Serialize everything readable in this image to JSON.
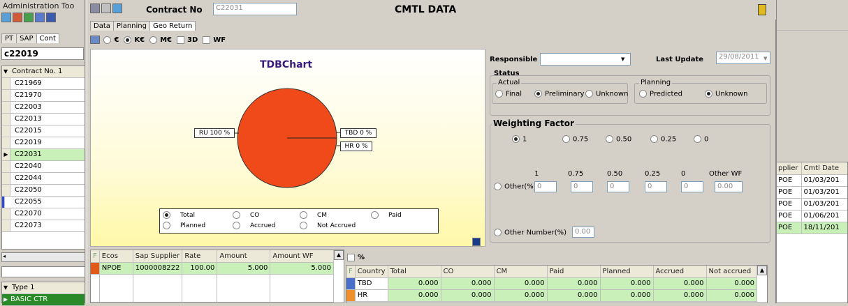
{
  "left_panel": {
    "menu_label": "Administration  Too",
    "tabs": [
      "PT",
      "SAP",
      "Cont"
    ],
    "current_contract": "c22019",
    "list_header": "Contract No. 1",
    "contracts": [
      "C21969",
      "C21970",
      "C22003",
      "C22013",
      "C22015",
      "C22019",
      "C22031",
      "C22040",
      "C22044",
      "C22050",
      "C22055",
      "C22070",
      "C22073"
    ],
    "type_header": "Type 1",
    "type_row": "BASIC CTR"
  },
  "window": {
    "contract_label": "Contract No",
    "contract_value": "C22031",
    "title": "CMTL DATA",
    "tabs": [
      "Data",
      "Planning",
      "Geo Return"
    ],
    "currency_options": [
      "€",
      "K€",
      "M€"
    ],
    "currency_selected": "K€",
    "view_options": [
      "3D",
      "WF"
    ]
  },
  "chart": {
    "title": "TDBChart",
    "labels": [
      "RU 100 %",
      "TBD 0 %",
      "HR 0 %"
    ],
    "color": "#f04a1a"
  },
  "chart_data": {
    "type": "pie",
    "title": "TDBChart",
    "categories": [
      "RU",
      "TBD",
      "HR"
    ],
    "values": [
      100,
      0,
      0
    ]
  },
  "chart_options": {
    "row1": [
      "Total",
      "CO",
      "CM",
      "Paid"
    ],
    "row2": [
      "Planned",
      "Accrued",
      "Not Accrued"
    ],
    "selected": "Total"
  },
  "details": {
    "responsible_label": "Responsible",
    "responsible_value": "",
    "last_update_label": "Last Update",
    "last_update_value": "29/08/2011",
    "status_label": "Status",
    "actual_label": "Actual",
    "actual_options": [
      "Final",
      "Preliminary",
      "Unknown"
    ],
    "actual_selected": "Preliminary",
    "planning_label": "Planning",
    "planning_options": [
      "Predicted",
      "Unknown"
    ],
    "planning_selected": "Unknown",
    "weighting_label": "Weighting Factor",
    "weight_options": [
      "1",
      "0.75",
      "0.50",
      "0.25",
      "0"
    ],
    "weight_selected": "1",
    "other_headers": [
      "1",
      "0.75",
      "0.50",
      "0.25",
      "0",
      "Other WF"
    ],
    "other_label": "Other(%)",
    "other_values": [
      "0",
      "0",
      "0",
      "0",
      "0",
      "0.00"
    ],
    "other_number_label": "Other Number(%)",
    "other_number_value": "0.00"
  },
  "supplier_table": {
    "headers": [
      "F",
      "Ecos",
      "Sap Supplier",
      "Rate",
      "Amount",
      "Amount WF"
    ],
    "rows": [
      {
        "ecos": "NPOE",
        "sap": "1000008222",
        "rate": "100.00",
        "amount": "5.000",
        "amount_wf": "5.000"
      }
    ]
  },
  "country_table": {
    "percent_label": "%",
    "headers": [
      "F",
      "Country",
      "Total",
      "CO",
      "CM",
      "Paid",
      "Planned",
      "Accrued",
      "Not accrued"
    ],
    "rows": [
      {
        "country": "TBD",
        "values": [
          "0.000",
          "0.000",
          "0.000",
          "0.000",
          "0.000",
          "0.000",
          "0.000"
        ],
        "flag": "#4a6fc8"
      },
      {
        "country": "HR",
        "values": [
          "0.000",
          "0.000",
          "0.000",
          "0.000",
          "0.000",
          "0.000",
          "0.000"
        ],
        "flag": "#f0902a"
      }
    ]
  },
  "right_table": {
    "headers": [
      "pplier",
      "Cmtl Date"
    ],
    "rows": [
      [
        "POE",
        "01/03/201"
      ],
      [
        "POE",
        "01/03/201"
      ],
      [
        "POE",
        "01/03/201"
      ],
      [
        "POE",
        "01/06/201"
      ],
      [
        "POE",
        "18/11/201"
      ]
    ]
  }
}
